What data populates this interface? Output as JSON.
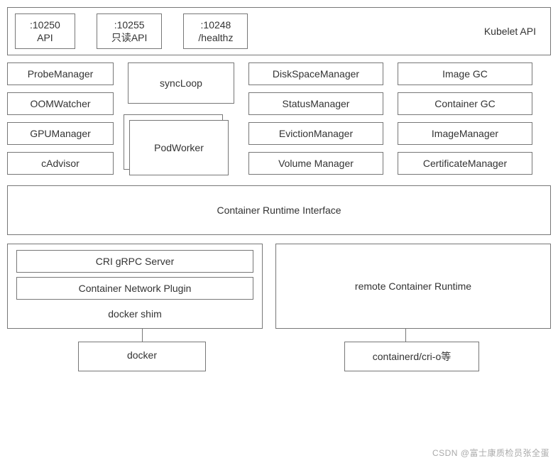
{
  "header": {
    "api1_port": ":10250",
    "api1_label": "API",
    "api2_port": ":10255",
    "api2_label": "只读API",
    "api3_port": ":10248",
    "api3_label": "/healthz",
    "title": "Kubelet API"
  },
  "col1": {
    "b0": "ProbeManager",
    "b1": "OOMWatcher",
    "b2": "GPUManager",
    "b3": "cAdvisor"
  },
  "col2": {
    "syncloop": "syncLoop",
    "podworker": "PodWorker"
  },
  "col3": {
    "b0": "DiskSpaceManager",
    "b1": "StatusManager",
    "b2": "EvictionManager",
    "b3": "Volume Manager"
  },
  "col4": {
    "b0": "Image GC",
    "b1": "Container GC",
    "b2": "ImageManager",
    "b3": "CertificateManager"
  },
  "cri": "Container Runtime Interface",
  "shim": {
    "grpc": "CRI gRPC Server",
    "cnp": "Container Network Plugin",
    "label": "docker shim"
  },
  "remote": "remote Container Runtime",
  "leaf": {
    "docker": "docker",
    "containerd": "containerd/cri-o等"
  },
  "watermark": "CSDN @富士康质检员张全蛋"
}
